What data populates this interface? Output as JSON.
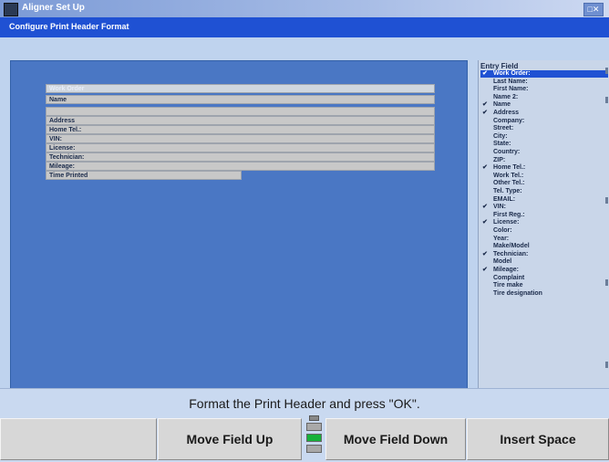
{
  "window": {
    "title": "Aligner Set Up",
    "subtitle": "Configure Print Header Format",
    "window_buttons": "□✕"
  },
  "header_rows": [
    "Work Order",
    "Name",
    "",
    "Address",
    "Home Tel.:",
    "VIN:",
    "License:",
    "Technician:",
    "Mileage:",
    "Time Printed"
  ],
  "field_list": {
    "header": "Entry Field",
    "items": [
      {
        "label": "Work Order:",
        "checked": true,
        "selected": true
      },
      {
        "label": "Last Name:",
        "checked": false
      },
      {
        "label": "First Name:",
        "checked": false
      },
      {
        "label": "Name 2:",
        "checked": false
      },
      {
        "label": "Name",
        "checked": true
      },
      {
        "label": "Address",
        "checked": true
      },
      {
        "label": "Company:",
        "checked": false
      },
      {
        "label": "Street:",
        "checked": false
      },
      {
        "label": "City:",
        "checked": false
      },
      {
        "label": "State:",
        "checked": false
      },
      {
        "label": "Country:",
        "checked": false
      },
      {
        "label": "ZIP:",
        "checked": false
      },
      {
        "label": "Home Tel.:",
        "checked": true
      },
      {
        "label": "Work Tel.:",
        "checked": false
      },
      {
        "label": "Other Tel.:",
        "checked": false
      },
      {
        "label": "Tel. Type:",
        "checked": false
      },
      {
        "label": "EMAIL:",
        "checked": false
      },
      {
        "label": "VIN:",
        "checked": true
      },
      {
        "label": "First Reg.:",
        "checked": false
      },
      {
        "label": "License:",
        "checked": true
      },
      {
        "label": "Color:",
        "checked": false
      },
      {
        "label": "Year:",
        "checked": false
      },
      {
        "label": "Make/Model",
        "checked": false
      },
      {
        "label": "Technician:",
        "checked": true
      },
      {
        "label": "Model",
        "checked": false
      },
      {
        "label": "Mileage:",
        "checked": true
      },
      {
        "label": "Complaint",
        "checked": false
      },
      {
        "label": "Tire make",
        "checked": false
      },
      {
        "label": "Tire designation",
        "checked": false
      }
    ]
  },
  "message": "Format the Print Header and press \"OK\".",
  "buttons": {
    "blank": "",
    "move_up": "Move Field Up",
    "move_down": "Move Field Down",
    "insert_space": "Insert Space"
  },
  "indicator": {
    "icon": "page-position-indicator-icon",
    "lamps": [
      false,
      true,
      false
    ],
    "active_color": "#16b13b"
  },
  "colors": {
    "canvas": "#4a77c4",
    "selection": "#1f51d3"
  }
}
